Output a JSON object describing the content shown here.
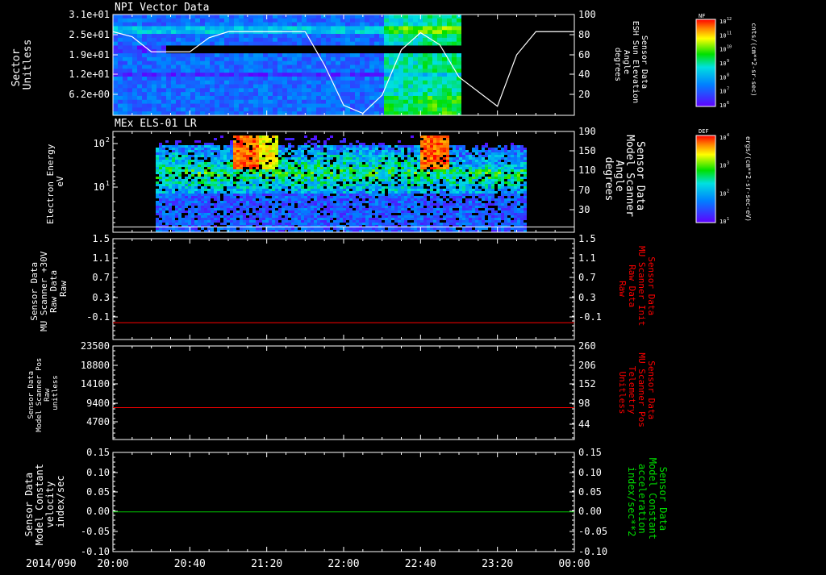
{
  "footer": {
    "date_label": "2014/090",
    "time_ticks": [
      "20:00",
      "20:40",
      "21:20",
      "22:00",
      "22:40",
      "23:20",
      "00:00"
    ]
  },
  "colors": {
    "background": "#000000",
    "axis": "#ffffff",
    "red_trace": "#ff0000",
    "green_trace": "#00cc00"
  },
  "chart_data": [
    {
      "type": "heatmap",
      "title": "NPI Vector Data",
      "ylabel_lines": [
        "Sector",
        "Unitless"
      ],
      "y_ticks": [
        "3.1e+01",
        "2.5e+01",
        "1.9e+01",
        "1.2e+01",
        "6.2e+00"
      ],
      "y2label_lines": [
        "Sensor Data",
        "ESH Sun Elevation",
        "Angle",
        "degrees"
      ],
      "y2_ticks": [
        "100",
        "80",
        "60",
        "40",
        "20"
      ],
      "y2lim": [
        0,
        100
      ],
      "overlay_line": {
        "name": "ESH Sun Elevation Angle",
        "x": [
          "20:00",
          "20:10",
          "20:20",
          "20:40",
          "20:50",
          "21:00",
          "21:20",
          "21:40",
          "21:50",
          "22:00",
          "22:10",
          "22:20",
          "22:30",
          "22:40",
          "22:50",
          "23:00",
          "23:20",
          "23:30",
          "23:40",
          "00:00"
        ],
        "y": [
          83,
          78,
          63,
          63,
          77,
          83,
          83,
          83,
          50,
          10,
          2,
          20,
          65,
          82,
          70,
          38,
          9,
          60,
          83,
          83
        ]
      },
      "colorbar": {
        "label": "NF",
        "units": "cnts/(cm**2-sr-sec)",
        "ticks": [
          "10^12",
          "10^11",
          "10^10",
          "10^9",
          "10^8",
          "10^7",
          "10^6"
        ]
      }
    },
    {
      "type": "heatmap",
      "title": "MEx ELS-01 LR",
      "ylabel_lines": [
        "Electron Energy",
        "eV"
      ],
      "y_ticks": [
        "10^2",
        "10^1"
      ],
      "y2label_lines": [
        "Sensor Data",
        "Model Scanner",
        "Angle",
        "degrees"
      ],
      "y2_ticks": [
        "190",
        "150",
        "110",
        "70",
        "30"
      ],
      "y2lim": [
        0,
        190
      ],
      "overlay_line": {
        "name": "Model Scanner Angle",
        "x": [
          "20:00",
          "00:00"
        ],
        "y": [
          10,
          10
        ]
      },
      "colorbar": {
        "label": "DEF",
        "units": "ergs/(cm**2-sr-sec-eV)",
        "ticks": [
          "10^4",
          "10^3",
          "10^2",
          "10^1"
        ]
      }
    },
    {
      "type": "line",
      "ylabel_lines": [
        "Sensor Data",
        "MU Scanner +30V",
        "Raw Data",
        "Raw"
      ],
      "y_ticks": [
        "1.5",
        "1.1",
        "0.7",
        "0.3",
        "-0.1"
      ],
      "y2label_lines": [
        "Sensor Data",
        "MU Scanner Init",
        "Raw Data",
        "Raw"
      ],
      "y2_ticks": [
        "1.5",
        "1.1",
        "0.7",
        "0.3",
        "-0.1"
      ],
      "ylim": [
        -0.3,
        1.5
      ],
      "series": [
        {
          "x": [
            "20:00",
            "00:00"
          ],
          "y": [
            0.0,
            0.0
          ],
          "color": "#ff0000"
        }
      ]
    },
    {
      "type": "line",
      "ylabel_lines": [
        "Sensor Data",
        "Model Scanner Pos",
        "Raw",
        "unitless"
      ],
      "y_ticks": [
        "23500",
        "18800",
        "14100",
        "9400",
        "4700"
      ],
      "y2label_lines": [
        "Sensor Data",
        "MU Scanner Pos",
        "Telemetry",
        "Unitless"
      ],
      "y2_ticks": [
        "260",
        "206",
        "152",
        "98",
        "44"
      ],
      "ylim": [
        0,
        23500
      ],
      "series": [
        {
          "x": [
            "20:00",
            "00:00"
          ],
          "y": [
            8000,
            8000
          ],
          "color": "#ff0000"
        }
      ]
    },
    {
      "type": "line",
      "ylabel_lines": [
        "Sensor Data",
        "Model Constant",
        "velocity",
        "index/sec"
      ],
      "y_ticks": [
        "0.15",
        "0.10",
        "0.05",
        "0.00",
        "-0.05",
        "-0.10"
      ],
      "y2label_lines": [
        "Sensor Data",
        "Model Constant",
        "acceleration",
        "index/sec**2"
      ],
      "y2_ticks": [
        "0.15",
        "0.10",
        "0.05",
        "0.00",
        "-0.05",
        "-0.10"
      ],
      "ylim": [
        -0.1,
        0.15
      ],
      "series": [
        {
          "x": [
            "20:00",
            "00:00"
          ],
          "y": [
            0.0,
            0.0
          ],
          "color": "#00cc00"
        }
      ]
    }
  ]
}
